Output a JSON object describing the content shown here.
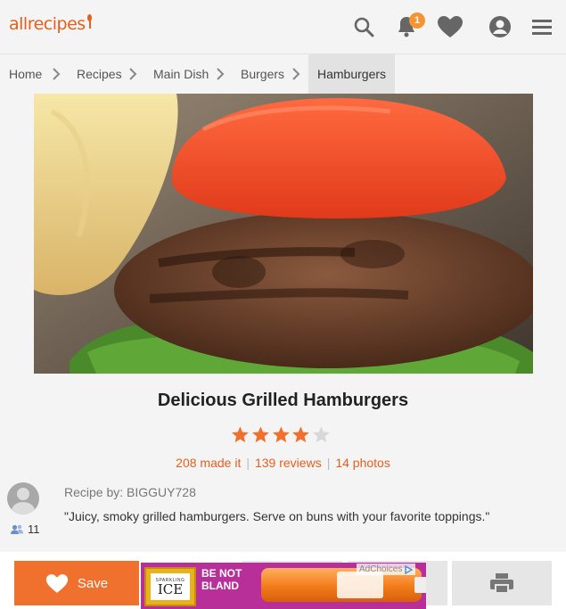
{
  "header": {
    "logo_text": "allrecipes",
    "notification_count": "1",
    "icons": [
      "search-icon",
      "bell-icon",
      "heart-icon",
      "profile-icon",
      "menu-icon"
    ]
  },
  "breadcrumb": {
    "items": [
      "Home",
      "Recipes",
      "Main Dish",
      "Burgers"
    ],
    "current": "Hamburgers"
  },
  "recipe": {
    "title": "Delicious Grilled Hamburgers",
    "rating": 4,
    "rating_max": 5,
    "made_it": "208 made it",
    "reviews": "139 reviews",
    "photos": "14 photos",
    "author_label": "Recipe by:",
    "author": "BIGGUY728",
    "followers": "11",
    "description": "\"Juicy, smoky grilled hamburgers. Serve on buns with your favorite toppings.\""
  },
  "actions": {
    "save_label": "Save"
  },
  "ad": {
    "brand_small": "SPARKLING",
    "brand_large": "ICE",
    "tagline": "BE NOT BLAND",
    "adchoices": "AdChoices"
  },
  "colors": {
    "accent": "#e85e1c",
    "save_button": "#f0702d",
    "star_filled": "#f0702d",
    "star_empty": "#d8d8d8",
    "badge": "#f49433"
  }
}
